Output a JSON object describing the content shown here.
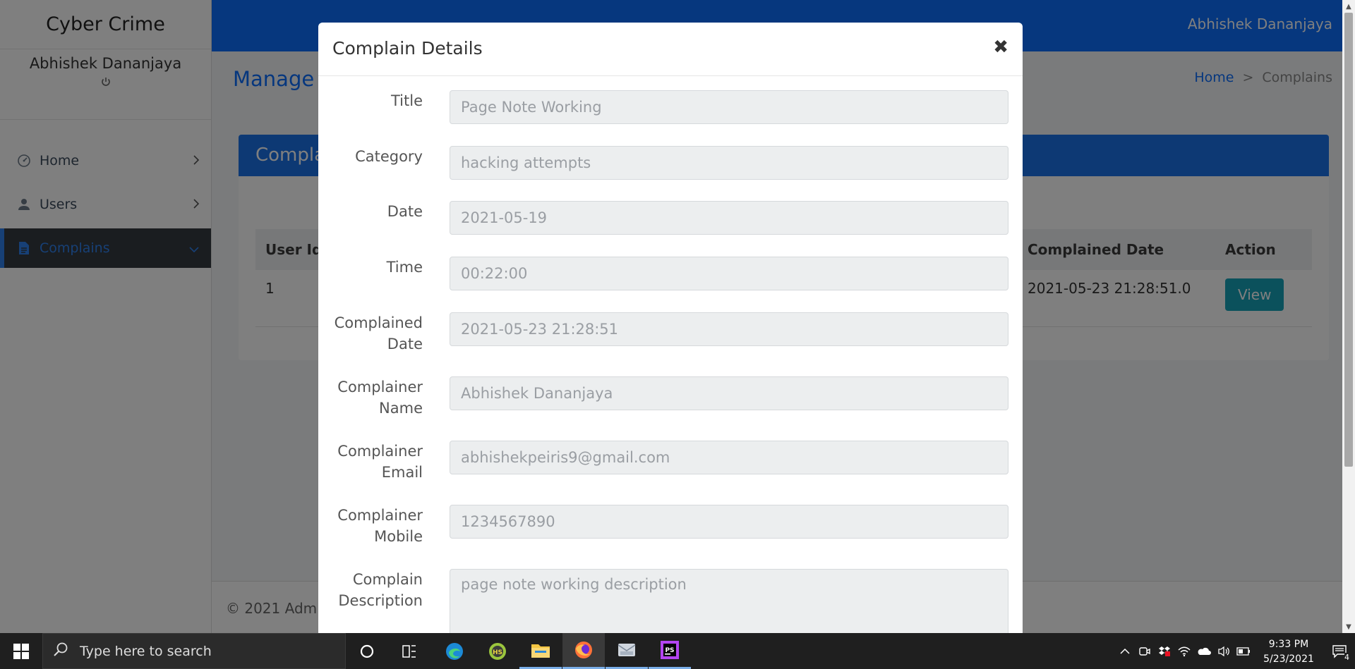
{
  "app": {
    "brand": "Cyber Crime",
    "profile_name": "Abhishek Dananjaya",
    "topbar_user": "Abhishek Dananjaya"
  },
  "sidebar": {
    "items": [
      {
        "label": "Home",
        "icon": "dashboard-icon"
      },
      {
        "label": "Users",
        "icon": "user-icon"
      },
      {
        "label": "Complains",
        "icon": "document-icon",
        "active": true
      }
    ]
  },
  "content": {
    "title": "Manage C",
    "breadcrumb": {
      "home": "Home",
      "separator": ">",
      "current": "Complains"
    },
    "card_title": "Compla",
    "table": {
      "headers": [
        "User Id",
        "Complained Date",
        "Action"
      ],
      "rows": [
        {
          "user_id": "1",
          "complained_date": "2021-05-23 21:28:51.0",
          "action_label": "View"
        }
      ]
    },
    "footer": "© 2021 Admin"
  },
  "modal": {
    "title": "Complain Details",
    "close_symbol": "✖",
    "fields": [
      {
        "label": "Title",
        "value": "Page Note Working"
      },
      {
        "label": "Category",
        "value": "hacking attempts"
      },
      {
        "label": "Date",
        "value": "2021-05-19"
      },
      {
        "label": "Time",
        "value": "00:22:00"
      },
      {
        "label_line1": "Complained",
        "label_line2": "Date",
        "value": "2021-05-23 21:28:51"
      },
      {
        "label_line1": "Complainer",
        "label_line2": "Name",
        "value": "Abhishek Dananjaya"
      },
      {
        "label_line1": "Complainer",
        "label_line2": "Email",
        "value": "abhishekpeiris9@gmail.com"
      },
      {
        "label_line1": "Complainer",
        "label_line2": "Mobile",
        "value": "1234567890"
      },
      {
        "label_line1": "Complain",
        "label_line2": "Description",
        "value": "page note working description"
      }
    ]
  },
  "taskbar": {
    "search_placeholder": "Type here to search",
    "time": "9:33 PM",
    "date": "5/23/2021",
    "notification_count": "4",
    "accent": "#7aaee8"
  },
  "colors": {
    "primary": "#0d6efd",
    "info": "#17a2b8",
    "sidebar_active_bg": "#343a40"
  }
}
